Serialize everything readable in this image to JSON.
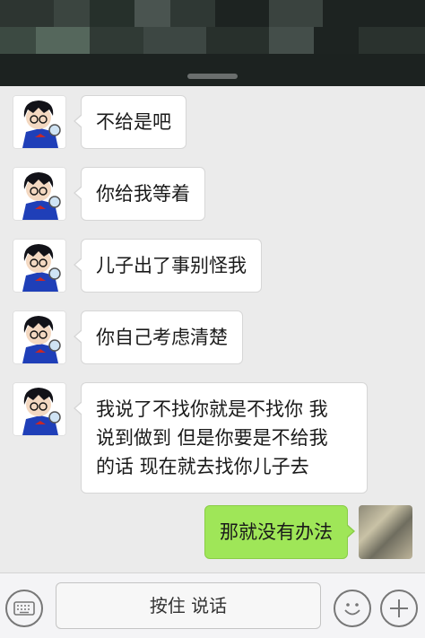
{
  "messages": [
    {
      "side": "left",
      "text": "不给是吧"
    },
    {
      "side": "left",
      "text": "你给我等着"
    },
    {
      "side": "left",
      "text": "儿子出了事别怪我"
    },
    {
      "side": "left",
      "text": "你自己考虑清楚"
    },
    {
      "side": "left",
      "lines": [
        "我说了不找你就是不找你 我",
        "说到做到 但是你要是不给我",
        "的话  现在就去找你儿子去"
      ]
    },
    {
      "side": "right",
      "text": "那就没有办法"
    }
  ],
  "footer": {
    "voice_hold_label": "按住 说话",
    "left_icon": "keyboard-icon",
    "emoji_icon": "emoji-icon",
    "plus_icon": "plus-icon"
  },
  "colors": {
    "chat_bg": "#ebebeb",
    "sent_bubble": "#9fe658",
    "received_bubble": "#ffffff",
    "header_bg": "#1d2321"
  }
}
